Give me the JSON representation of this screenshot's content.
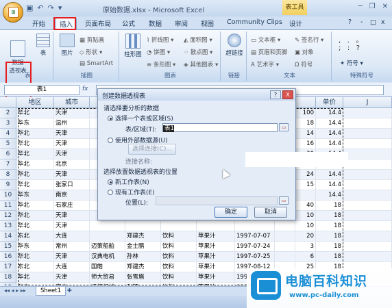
{
  "window": {
    "title": "原始数据.xlsx - Microsoft Excel",
    "tool_tab_header": "表工具",
    "office_button_icon": "office-logo-icon",
    "qat_icons": [
      "save-icon",
      "undo-icon",
      "redo-icon"
    ],
    "controls": [
      "minimize-icon",
      "restore-icon",
      "close-icon"
    ]
  },
  "tabs": [
    "开始",
    "插入",
    "页面布局",
    "公式",
    "数据",
    "审阅",
    "视图",
    "Community Clips",
    "设计"
  ],
  "tab_right": {
    "help": "?",
    "minimize": "-",
    "restore": "□",
    "close": "x"
  },
  "ribbon": {
    "table_group": {
      "label": "表",
      "pivot": "数据\n透视表",
      "table": "表"
    },
    "illus_group": {
      "label": "插图",
      "picture": "图片",
      "clipart": "剪贴画",
      "shapes": "形状",
      "smartart": "SmartArt"
    },
    "chart_group": {
      "label": "图表",
      "column": "柱形图",
      "line": "折线图",
      "pie": "饼图",
      "bar": "条形图",
      "area": "面积图",
      "scatter": "散点图",
      "other": "其他图表"
    },
    "links_group": {
      "label": "链接",
      "hyperlink": "超链接"
    },
    "text_group": {
      "label": "文本",
      "textbox": "文本框",
      "header": "页眉和页脚",
      "wordart": "艺术字",
      "signature": "签名行",
      "object": "对象",
      "symbol": "符号"
    },
    "special_group": {
      "label": "特殊符号",
      "symbol": "符号"
    }
  },
  "formula_bar": {
    "name_box": "表1",
    "fx": "fx",
    "value": ""
  },
  "columns": [
    "地区",
    "城市",
    "",
    "",
    "",
    "",
    "",
    "",
    "",
    "单价",
    "J"
  ],
  "col_letters": {
    "A": "A",
    "B": "B"
  },
  "rows": [
    {
      "n": "2",
      "a": "华北",
      "b": "天津",
      "i": "100",
      "j": "14.4"
    },
    {
      "n": "3",
      "a": "华东",
      "b": "温州",
      "i": "18",
      "j": "14.4"
    },
    {
      "n": "4",
      "a": "华北",
      "b": "天津",
      "i": "14",
      "j": "14.4"
    },
    {
      "n": "5",
      "a": "华北",
      "b": "天津",
      "i": "16",
      "j": "14.4"
    },
    {
      "n": "6",
      "a": "华北",
      "b": "天津",
      "i": "30",
      "j": "14.4"
    },
    {
      "n": "7",
      "a": "华北",
      "b": "北京",
      "i": "",
      "j": "14.4"
    },
    {
      "n": "8",
      "a": "华北",
      "b": "天津",
      "i": "24",
      "j": "14.4"
    },
    {
      "n": "9",
      "a": "华北",
      "b": "张家口",
      "i": "15",
      "j": "14.4"
    },
    {
      "n": "10",
      "a": "华东",
      "b": "南京",
      "i": "",
      "j": "14.4"
    },
    {
      "n": "11",
      "a": "华北",
      "b": "石家庄",
      "i": "40",
      "j": "18"
    },
    {
      "n": "12",
      "a": "华北",
      "b": "天津",
      "i": "10",
      "j": "18"
    },
    {
      "n": "13",
      "a": "华北",
      "b": "天津",
      "i": "10",
      "j": "18"
    },
    {
      "n": "14",
      "a": "东北",
      "b": "大连",
      "c": "",
      "d": "郑建杰",
      "e": "饮料",
      "f": "苹果汁",
      "g": "1997-07-07",
      "i": "20",
      "j": "18"
    },
    {
      "n": "15",
      "a": "华东",
      "b": "常州",
      "c": "迈策船舶",
      "d": "金士鹏",
      "e": "饮料",
      "f": "苹果汁",
      "g": "1997-07-24",
      "i": "3",
      "j": "18"
    },
    {
      "n": "16",
      "a": "华北",
      "b": "天津",
      "c": "汉典电机",
      "d": "孙林",
      "e": "饮料",
      "f": "苹果汁",
      "g": "1997-07-25",
      "i": "6",
      "j": "18"
    },
    {
      "n": "17",
      "a": "东北",
      "b": "大连",
      "c": "国皓",
      "d": "郑建杰",
      "e": "饮料",
      "f": "苹果汁",
      "g": "1997-08-12",
      "i": "25",
      "j": "18"
    },
    {
      "n": "18",
      "a": "华北",
      "b": "天津",
      "c": "师大贸易",
      "d": "张雪眉",
      "e": "饮料",
      "f": "苹果汁",
      "g": "1997-08-27",
      "i": "15",
      "j": "18"
    },
    {
      "n": "19",
      "a": "华东",
      "b": "南京",
      "c": "通恒机械",
      "d": "张颖",
      "e": "饮料",
      "f": "苹果汁",
      "g": "1997-09-22",
      "i": "",
      "j": "18"
    },
    {
      "n": "20",
      "a": "华北",
      "b": "天津",
      "c": "高上补习班",
      "d": "王伟",
      "e": "饮料",
      "f": "苹果汁",
      "g": "",
      "i": "",
      "j": "18"
    }
  ],
  "dialog": {
    "title": "创建数据透视表",
    "help": "?",
    "close": "X",
    "section1": "请选择要分析的数据",
    "opt_select_range": "选择一个表或区域(S)",
    "table_range_label": "表/区域(T):",
    "table_range_value": "表1",
    "opt_external": "使用外部数据源(U)",
    "choose_conn": "选择连接(C)...",
    "conn_name": "连接名称:",
    "section2": "选择放置数据透视表的位置",
    "opt_new_sheet": "新工作表(N)",
    "opt_existing": "现有工作表(E)",
    "location_label": "位置(L):",
    "ok": "确定",
    "cancel": "取消"
  },
  "sheet_tab": "Sheet1",
  "watermark": {
    "title": "电脑百科知识",
    "url": "www.pc-daily.com"
  }
}
